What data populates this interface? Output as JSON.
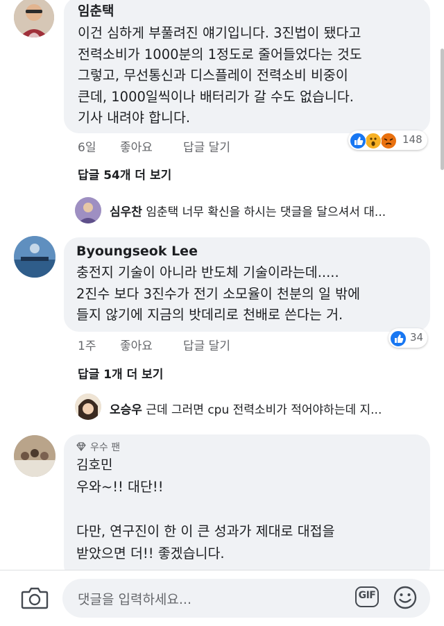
{
  "comments": [
    {
      "author": "임춘택",
      "lines": [
        "이건 심하게 부풀려진 얘기입니다. 3진법이 됐다고",
        "전력소비가 1000분의 1정도로 줄어들었다는 것도",
        "그렇고, 무선통신과 디스플레이 전력소비 비중이",
        "큰데, 1000일씩이나 배터리가 갈 수도 없습니다.",
        "기사 내려야 합니다."
      ],
      "time": "6일",
      "like_label": "좋아요",
      "reply_label": "답글 달기",
      "reaction_count": "148",
      "more_replies": "답글 54개 더 보기",
      "reply_preview": {
        "author": "심우찬",
        "text": "임춘택 너무 확신을 하시는 댓글을 달으셔서 대..."
      }
    },
    {
      "author": "Byoungseok Lee",
      "lines": [
        "충전지 기술이 아니라 반도체 기술이라는데.....",
        "2진수 보다 3진수가 전기 소모율이 천분의 일  밖에",
        "들지 않기에  지금의 밧데리로 천배로 쓴다는 거."
      ],
      "time": "1주",
      "like_label": "좋아요",
      "reply_label": "답글 달기",
      "reaction_count": "34",
      "more_replies": "답글 1개 더 보기",
      "reply_preview": {
        "author": "오승우",
        "text": "근데 그러면 cpu 전력소비가 적어야하는데 지..."
      }
    },
    {
      "badge": "우수 팬",
      "author": "김호민",
      "lines": [
        "우와~!! 대단!!",
        "",
        "다만, 연구진이 한 이 큰 성과가 제대로 대접을",
        "받았으면 더!! 좋겠습니다."
      ]
    }
  ],
  "composer": {
    "placeholder": "댓글을 입력하세요...",
    "gif_label": "GIF"
  },
  "colors": {
    "bubble": "#f0f2f5",
    "like_blue": "#1877f2",
    "wow_yellow": "#f7b125",
    "angry_orange": "#e9710f",
    "meta_gray": "#65676b"
  }
}
